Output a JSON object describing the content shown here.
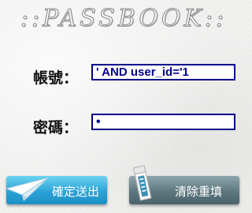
{
  "banner": {
    "title": "::PASSBOOK::"
  },
  "form": {
    "account_label": "帳號：",
    "account_value": "' AND user_id='1",
    "password_label": "密碼：",
    "password_value": "•"
  },
  "buttons": {
    "submit_label": "確定送出",
    "reset_label": "清除重填"
  },
  "colors": {
    "field_border": "#00008b",
    "submit_button": "#2aa3d6",
    "reset_button": "#5e7880"
  },
  "icons": {
    "submit": "paper-plane-icon",
    "reset": "eraser-icon"
  }
}
